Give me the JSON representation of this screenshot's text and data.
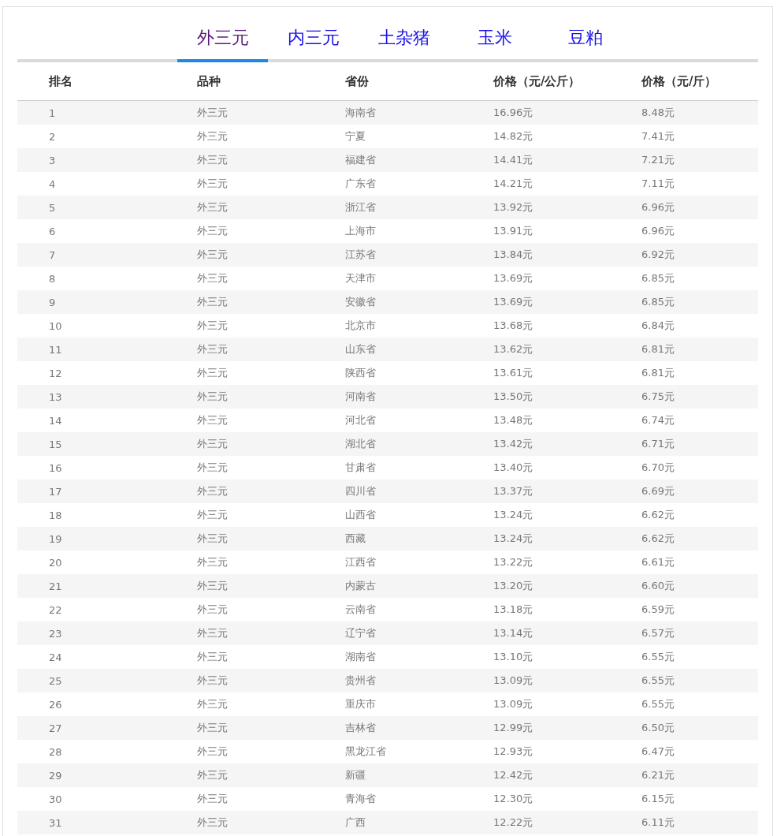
{
  "tabs": [
    {
      "label": "外三元",
      "selected": true
    },
    {
      "label": "内三元",
      "selected": false
    },
    {
      "label": "土杂猪",
      "selected": false
    },
    {
      "label": "玉米",
      "selected": false
    },
    {
      "label": "豆粕",
      "selected": false
    }
  ],
  "table": {
    "columns": [
      "排名",
      "品种",
      "省份",
      "价格（元/公斤）",
      "价格（元/斤）"
    ],
    "rows": [
      [
        "1",
        "外三元",
        "海南省",
        "16.96元",
        "8.48元"
      ],
      [
        "2",
        "外三元",
        "宁夏",
        "14.82元",
        "7.41元"
      ],
      [
        "3",
        "外三元",
        "福建省",
        "14.41元",
        "7.21元"
      ],
      [
        "4",
        "外三元",
        "广东省",
        "14.21元",
        "7.11元"
      ],
      [
        "5",
        "外三元",
        "浙江省",
        "13.92元",
        "6.96元"
      ],
      [
        "6",
        "外三元",
        "上海市",
        "13.91元",
        "6.96元"
      ],
      [
        "7",
        "外三元",
        "江苏省",
        "13.84元",
        "6.92元"
      ],
      [
        "8",
        "外三元",
        "天津市",
        "13.69元",
        "6.85元"
      ],
      [
        "9",
        "外三元",
        "安徽省",
        "13.69元",
        "6.85元"
      ],
      [
        "10",
        "外三元",
        "北京市",
        "13.68元",
        "6.84元"
      ],
      [
        "11",
        "外三元",
        "山东省",
        "13.62元",
        "6.81元"
      ],
      [
        "12",
        "外三元",
        "陕西省",
        "13.61元",
        "6.81元"
      ],
      [
        "13",
        "外三元",
        "河南省",
        "13.50元",
        "6.75元"
      ],
      [
        "14",
        "外三元",
        "河北省",
        "13.48元",
        "6.74元"
      ],
      [
        "15",
        "外三元",
        "湖北省",
        "13.42元",
        "6.71元"
      ],
      [
        "16",
        "外三元",
        "甘肃省",
        "13.40元",
        "6.70元"
      ],
      [
        "17",
        "外三元",
        "四川省",
        "13.37元",
        "6.69元"
      ],
      [
        "18",
        "外三元",
        "山西省",
        "13.24元",
        "6.62元"
      ],
      [
        "19",
        "外三元",
        "西藏",
        "13.24元",
        "6.62元"
      ],
      [
        "20",
        "外三元",
        "江西省",
        "13.22元",
        "6.61元"
      ],
      [
        "21",
        "外三元",
        "内蒙古",
        "13.20元",
        "6.60元"
      ],
      [
        "22",
        "外三元",
        "云南省",
        "13.18元",
        "6.59元"
      ],
      [
        "23",
        "外三元",
        "辽宁省",
        "13.14元",
        "6.57元"
      ],
      [
        "24",
        "外三元",
        "湖南省",
        "13.10元",
        "6.55元"
      ],
      [
        "25",
        "外三元",
        "贵州省",
        "13.09元",
        "6.55元"
      ],
      [
        "26",
        "外三元",
        "重庆市",
        "13.09元",
        "6.55元"
      ],
      [
        "27",
        "外三元",
        "吉林省",
        "12.99元",
        "6.50元"
      ],
      [
        "28",
        "外三元",
        "黑龙江省",
        "12.93元",
        "6.47元"
      ],
      [
        "29",
        "外三元",
        "新疆",
        "12.42元",
        "6.21元"
      ],
      [
        "30",
        "外三元",
        "青海省",
        "12.30元",
        "6.15元"
      ],
      [
        "31",
        "外三元",
        "广西",
        "12.22元",
        "6.11元"
      ]
    ]
  }
}
